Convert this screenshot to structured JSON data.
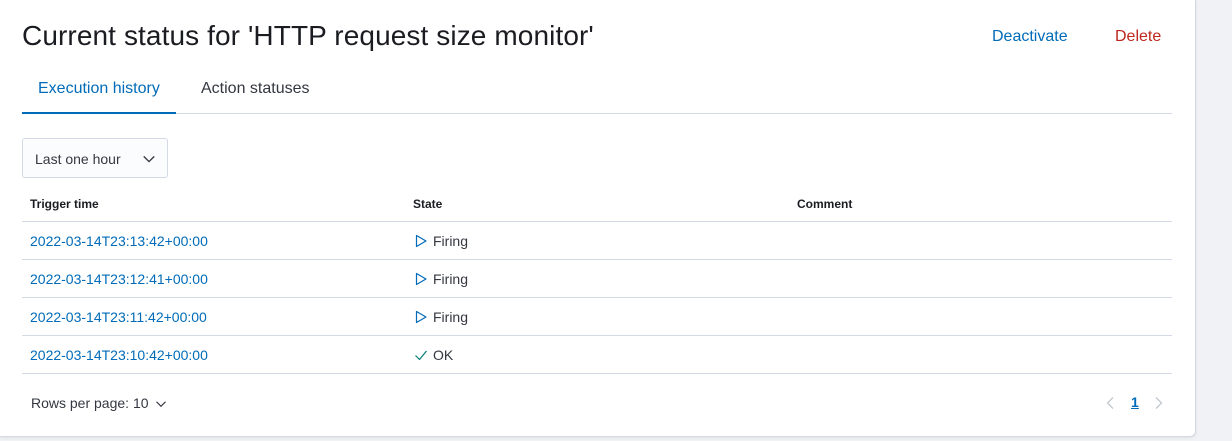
{
  "header": {
    "title": "Current status for 'HTTP request size monitor'",
    "deactivate_label": "Deactivate",
    "delete_label": "Delete"
  },
  "tabs": [
    {
      "label": "Execution history",
      "active": true
    },
    {
      "label": "Action statuses",
      "active": false
    }
  ],
  "time_range": {
    "selected": "Last one hour"
  },
  "table": {
    "columns": [
      "Trigger time",
      "State",
      "Comment"
    ],
    "rows": [
      {
        "trigger_time": "2022-03-14T23:13:42+00:00",
        "state": "Firing",
        "state_icon": "play-icon",
        "comment": ""
      },
      {
        "trigger_time": "2022-03-14T23:12:41+00:00",
        "state": "Firing",
        "state_icon": "play-icon",
        "comment": ""
      },
      {
        "trigger_time": "2022-03-14T23:11:42+00:00",
        "state": "Firing",
        "state_icon": "play-icon",
        "comment": ""
      },
      {
        "trigger_time": "2022-03-14T23:10:42+00:00",
        "state": "OK",
        "state_icon": "check-icon",
        "comment": ""
      }
    ]
  },
  "pagination": {
    "rows_per_page_label": "Rows per page: 10",
    "current_page": "1"
  },
  "colors": {
    "link": "#006bb8",
    "danger": "#bd271e",
    "border": "#d3dae6"
  }
}
